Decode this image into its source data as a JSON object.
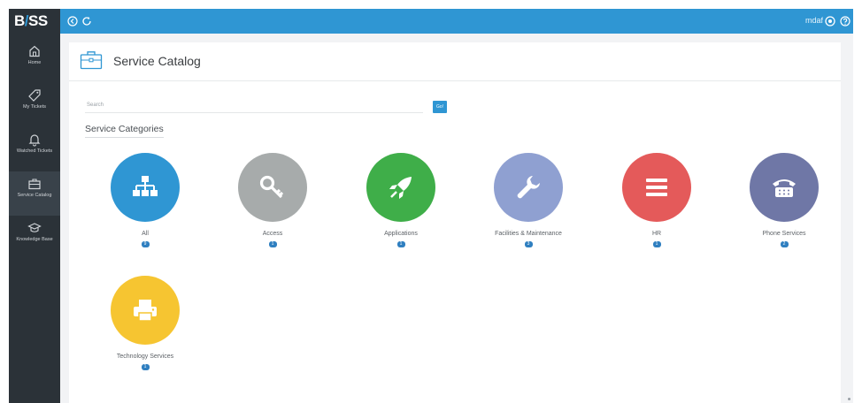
{
  "app": {
    "logo_prefix": "B",
    "logo_slash": "/",
    "logo_suffix": "SS",
    "username": "mdaf"
  },
  "colors": {
    "topbar": "#2f96d3",
    "sidebar": "#2b3238",
    "accent": "#2f96d3"
  },
  "sidebar": {
    "items": [
      {
        "label": "Home",
        "icon": "home-icon"
      },
      {
        "label": "My Tickets",
        "icon": "tag-icon"
      },
      {
        "label": "Watched Tickets",
        "icon": "bell-icon"
      },
      {
        "label": "Service Catalog",
        "icon": "briefcase-icon",
        "active": true
      },
      {
        "label": "Knowledge Base",
        "icon": "graduation-cap-icon"
      }
    ]
  },
  "page": {
    "title": "Service Catalog",
    "search_placeholder": "Search",
    "search_button": "Go!",
    "categories_heading": "Service Categories"
  },
  "categories": [
    {
      "name": "All",
      "count": "9",
      "color": "#2f96d3",
      "icon": "sitemap-icon"
    },
    {
      "name": "Access",
      "count": "1",
      "color": "#a7abab",
      "icon": "key-icon"
    },
    {
      "name": "Applications",
      "count": "1",
      "color": "#3fae49",
      "icon": "rocket-icon"
    },
    {
      "name": "Facilities & Maintenance",
      "count": "3",
      "color": "#8fa0d1",
      "icon": "wrench-icon"
    },
    {
      "name": "HR",
      "count": "1",
      "color": "#e45a5a",
      "icon": "list-icon"
    },
    {
      "name": "Phone Services",
      "count": "2",
      "color": "#6f77a6",
      "icon": "phone-icon"
    },
    {
      "name": "Technology Services",
      "count": "1",
      "color": "#f6c531",
      "icon": "printer-icon"
    }
  ]
}
